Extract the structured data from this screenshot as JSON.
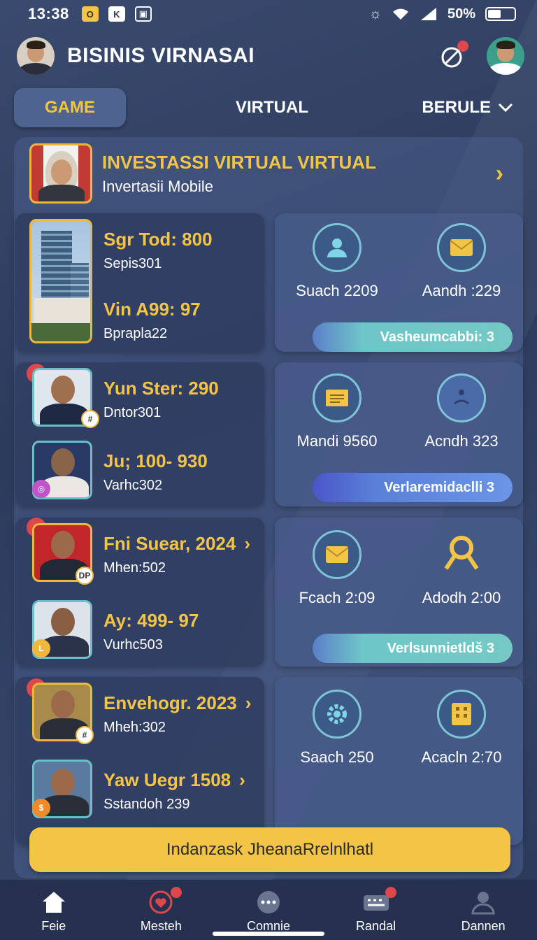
{
  "status": {
    "time": "13:38",
    "battery": "50%"
  },
  "header": {
    "title": "BISINIS VIRNASAI"
  },
  "tabs": [
    {
      "label": "GAME"
    },
    {
      "label": "VIRTUAL"
    },
    {
      "label": "BERULE"
    }
  ],
  "banner": {
    "title": "INVESTASSI VIRTUAL VIRTUAL",
    "subtitle": "Invertasii Mobile"
  },
  "rows": [
    {
      "left": [
        {
          "value": "Sgr Tod: 800",
          "sub": "Sepis301"
        },
        {
          "value": "Vin A99: 97",
          "sub": "Bpraplа22"
        }
      ],
      "right": [
        {
          "label": "Suach 2209",
          "icon": "person-chat-icon"
        },
        {
          "label": "Aandh :229",
          "icon": "mail-icon"
        }
      ],
      "pill": "Vasheumcabbi: 3"
    },
    {
      "left": [
        {
          "value": "Yun Ster: 290",
          "sub": "Dntor301",
          "badge": "1"
        },
        {
          "value": "Ju; 100- 930",
          "sub": "Varhc302"
        }
      ],
      "right": [
        {
          "label": "Mandi 9560",
          "icon": "envelope-icon"
        },
        {
          "label": "Acndh 323",
          "icon": "face-icon"
        }
      ],
      "pill": "Verlaremidaclli 3"
    },
    {
      "left": [
        {
          "value": "Fni Suear, 2024",
          "sub": "Mhen:502",
          "badge": "1"
        },
        {
          "value": "Ay: 499- 97",
          "sub": "Vurhc503"
        }
      ],
      "right": [
        {
          "label": "Fcach 2:09",
          "icon": "mail-icon"
        },
        {
          "label": "Adodh 2:00",
          "icon": "award-icon"
        }
      ],
      "pill": "Verlsunnietldš 3"
    },
    {
      "left": [
        {
          "value": "Envehogr. 2023",
          "sub": "Mheh:302",
          "badge": "1"
        },
        {
          "value": "Yaw Uegr 1508",
          "sub": "Sstandoh 239"
        }
      ],
      "right": [
        {
          "label": "Saach 250",
          "icon": "gear-chat-icon"
        },
        {
          "label": "Acacln 2:70",
          "icon": "building-icon"
        }
      ]
    }
  ],
  "cta": "Indanzask JheanaRrelnlhatl",
  "nav": [
    {
      "label": "Feie",
      "icon": "home-icon"
    },
    {
      "label": "Mesteh",
      "icon": "heart-clock-icon"
    },
    {
      "label": "Comnie",
      "icon": "chat-dots-icon"
    },
    {
      "label": "Randal",
      "icon": "keyboard-icon"
    },
    {
      "label": "Dannen",
      "icon": "profile-icon"
    }
  ]
}
